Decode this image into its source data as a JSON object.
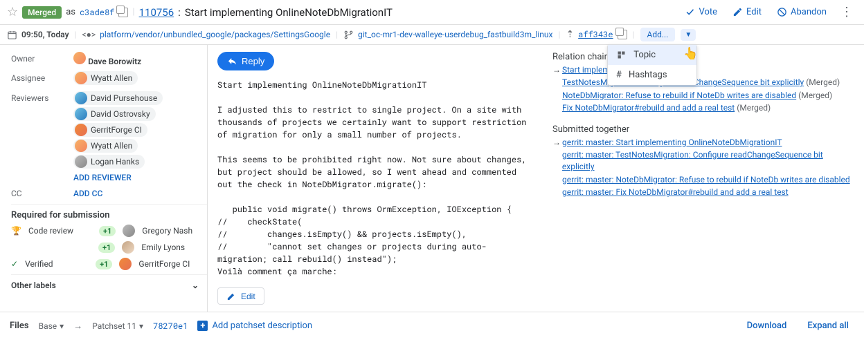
{
  "header": {
    "status": "Merged",
    "as": "as",
    "commit_short": "c3ade8f",
    "change_number": "110756",
    "title": "Start implementing OnlineNoteDbMigrationIT"
  },
  "actions": {
    "vote": "Vote",
    "edit": "Edit",
    "abandon": "Abandon"
  },
  "meta": {
    "updated": "09:50, Today",
    "project": "platform/vendor/unbundled_google/packages/SettingsGoogle",
    "branch": "git_oc-mr1-dev-walleye-userdebug_fastbuild3m_linux",
    "parent_sha": "aff343e",
    "add_label": "Add..."
  },
  "dropdown": {
    "topic": "Topic",
    "hashtags": "Hashtags"
  },
  "sidebar": {
    "owner_label": "Owner",
    "owner": "Dave Borowitz",
    "assignee_label": "Assignee",
    "assignee": "Wyatt Allen",
    "reviewers_label": "Reviewers",
    "reviewers": [
      "David Pursehouse",
      "David Ostrovsky",
      "GerritForge CI",
      "Wyatt Allen",
      "Logan Hanks"
    ],
    "add_reviewer": "ADD REVIEWER",
    "cc_label": "CC",
    "add_cc": "ADD CC",
    "required_h": "Required for submission",
    "labels": [
      {
        "name": "Code review",
        "score": "+1",
        "voters": [
          "Gregory Nash",
          "Emily Lyons"
        ],
        "icon": "trophy"
      },
      {
        "name": "Verified",
        "score": "+1",
        "voters": [
          "GerritForge CI"
        ],
        "icon": "check"
      }
    ],
    "other": "Other labels"
  },
  "message": {
    "reply": "Reply",
    "body": "Start implementing OnlineNoteDbMigrationIT\n\nI adjusted this to restrict to single project. On a site with\nthousands of projects we certainly want to support restriction\nof migration for only a small number of projects.\n\nThis seems to be prohibited right now. Not sure about changes,\nbut project should be allowed, so I went ahead and commented\nout the check in NoteDbMigrator.migrate():\n\n   public void migrate() throws OrmException, IOException {\n//    checkState(\n//        changes.isEmpty() && projects.isEmpty(),\n//        \"cannot set changes or projects during auto-migration; call rebuild() instead\");\nVoilà comment ça marche:",
    "edit": "Edit"
  },
  "relation": {
    "chain_h": "Relation chain",
    "chain": [
      {
        "text": "Start implementing OnlineNote",
        "status": "",
        "current": true
      },
      {
        "text": "TestNotesMigration: Configure readChangeSequence bit explicitly",
        "status": "(Merged)"
      },
      {
        "text": "NoteDbMigrator: Refuse to rebuild if NoteDb writes are disabled",
        "status": "(Merged)"
      },
      {
        "text": "Fix NoteDbMigrator#rebuild and add a real test",
        "status": "(Merged)"
      }
    ],
    "submitted_h": "Submitted together",
    "submitted": [
      {
        "text": "gerrit: master: Start implementing OnlineNoteDbMigrationIT",
        "current": true
      },
      {
        "text": "gerrit: master: TestNotesMigration: Configure readChangeSequence bit explicitly"
      },
      {
        "text": "gerrit: master: NoteDbMigrator: Refuse to rebuild if NoteDb writes are disabled"
      },
      {
        "text": "gerrit: master: Fix NoteDbMigrator#rebuild and add a real test"
      }
    ]
  },
  "files": {
    "heading": "Files",
    "base": "Base",
    "patchset": "Patchset 11",
    "sha": "78270e1",
    "add_desc": "Add patchset description",
    "download": "Download",
    "expand": "Expand all"
  }
}
